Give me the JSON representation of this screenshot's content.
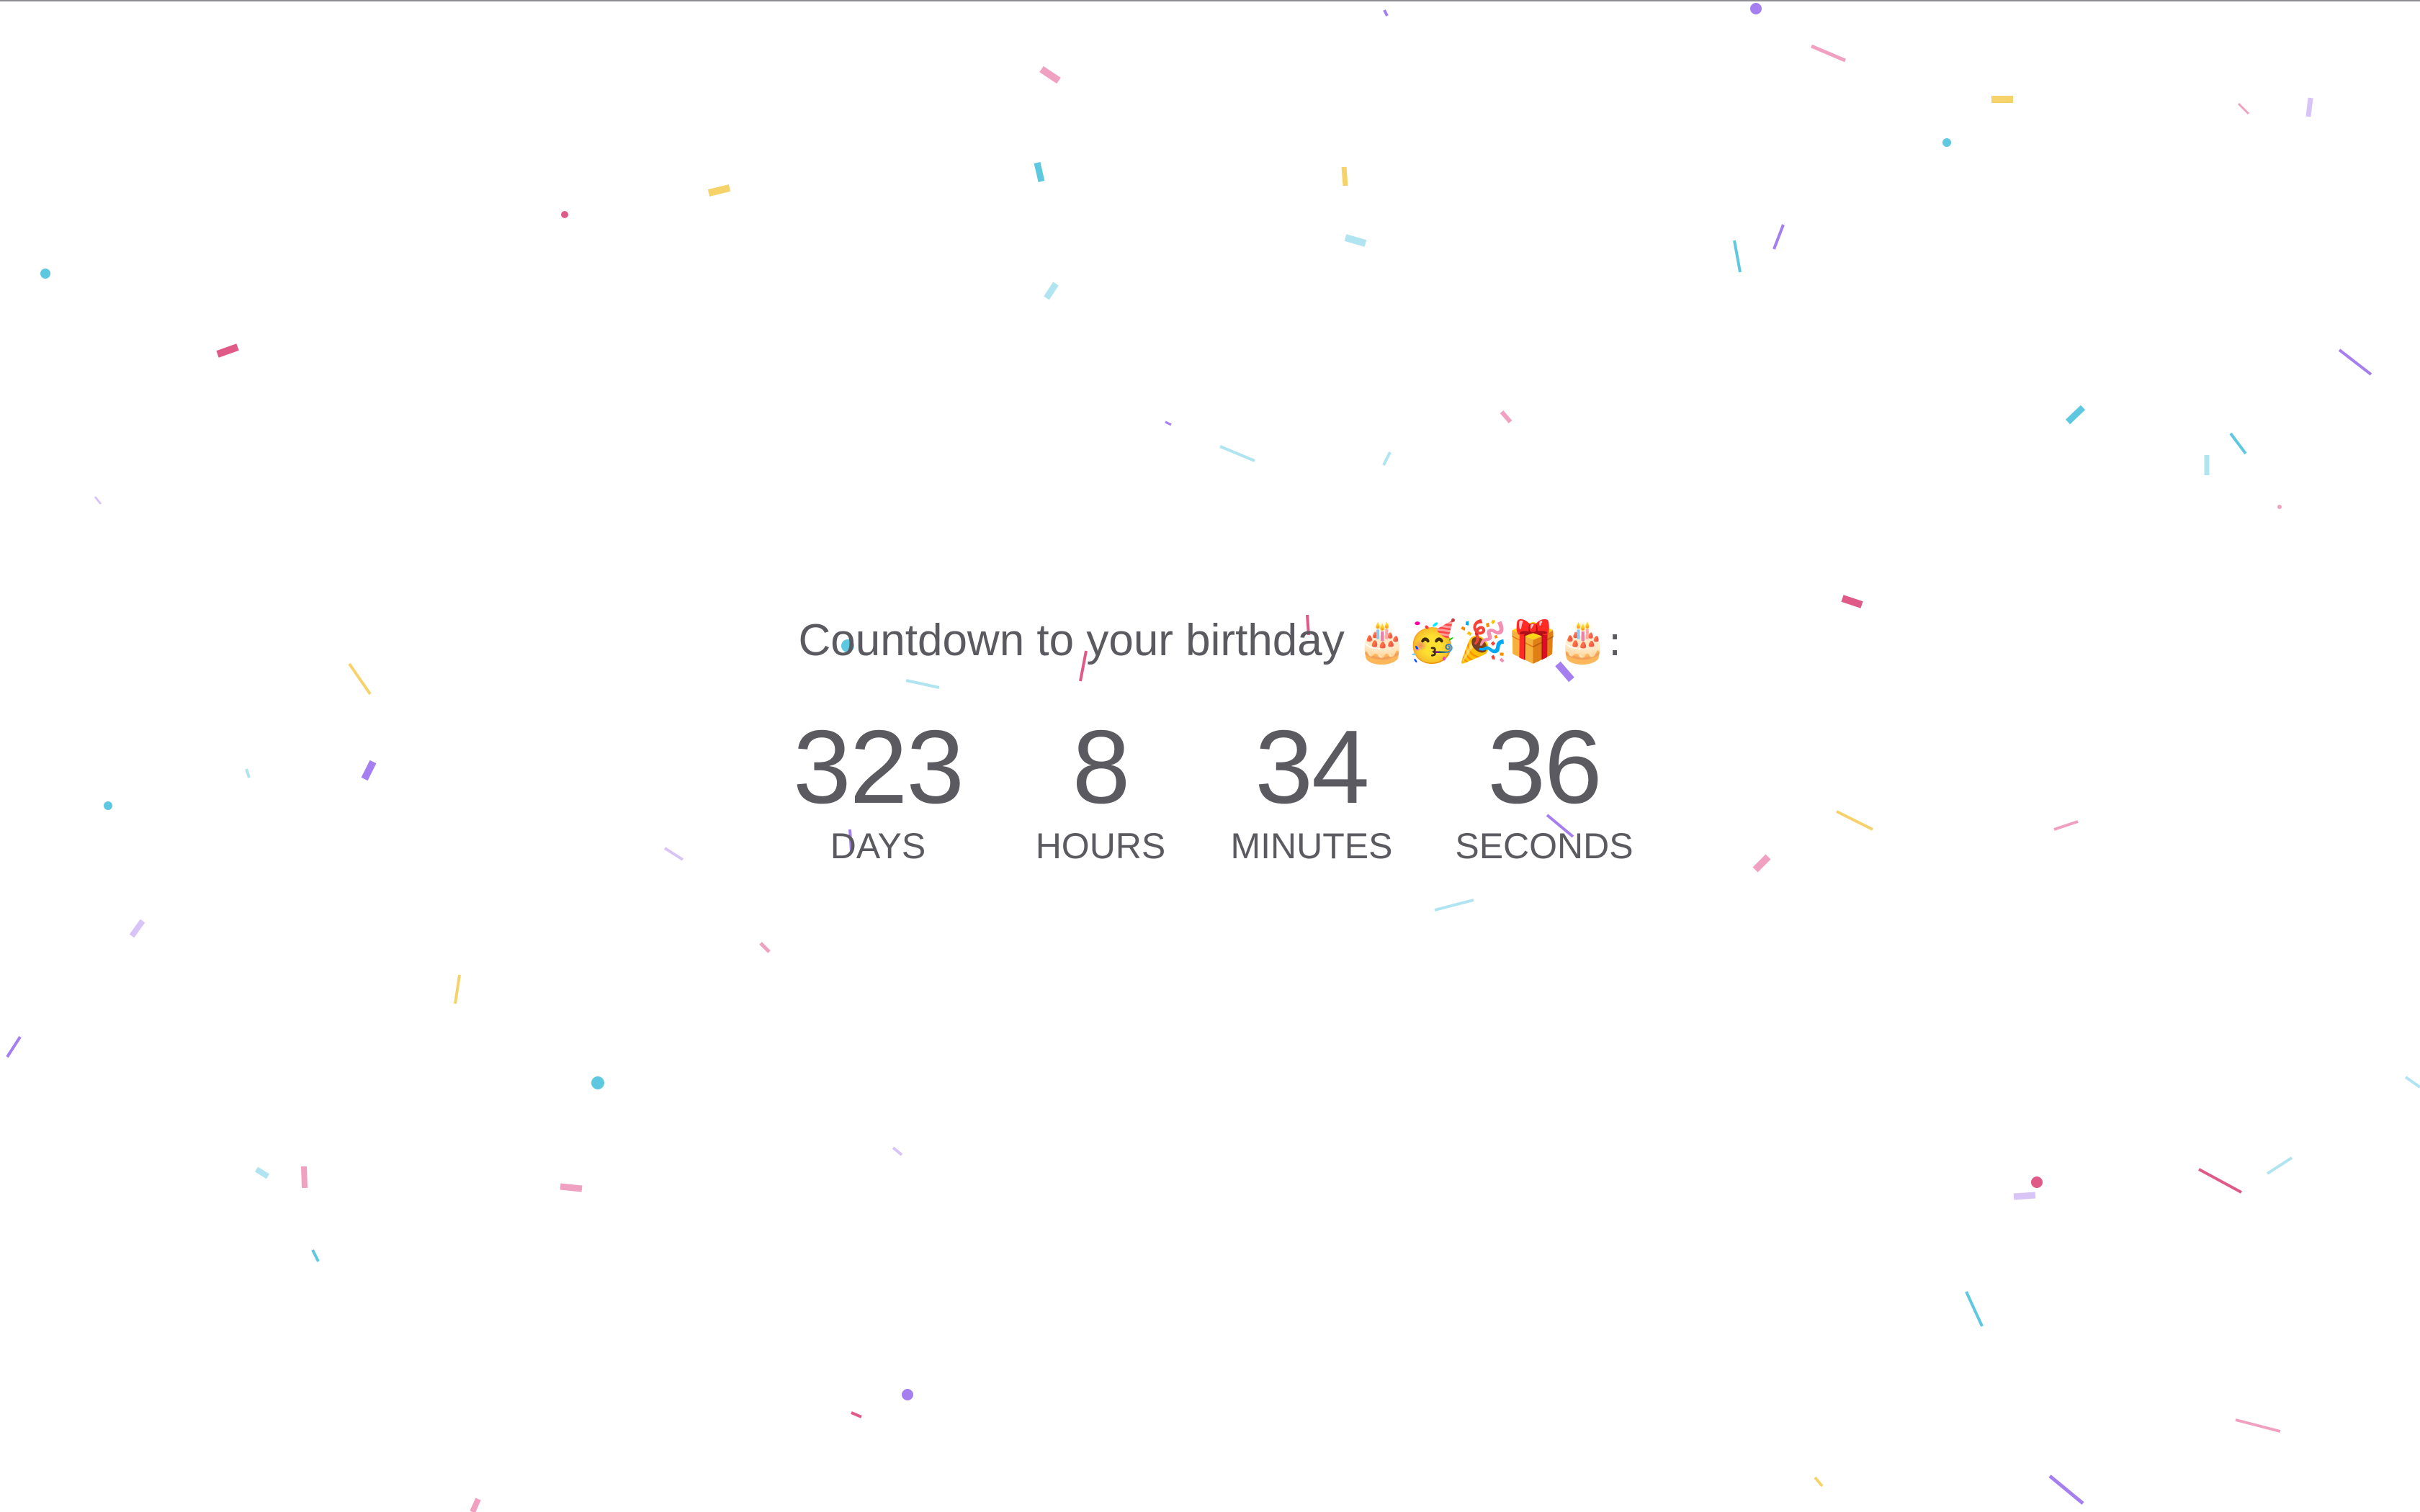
{
  "heading": {
    "text": "Countdown to your birthday",
    "emoji": "🎂🥳🎉🎁🎂:"
  },
  "countdown": {
    "days": {
      "value": "323",
      "label": "DAYS"
    },
    "hours": {
      "value": "8",
      "label": "HOURS"
    },
    "minutes": {
      "value": "34",
      "label": "MINUTES"
    },
    "seconds": {
      "value": "36",
      "label": "SECONDS"
    }
  },
  "colors": {
    "text": "#5a5a60",
    "background": "#ffffff",
    "confetti": [
      "#5ec8e0",
      "#a57ef0",
      "#e05a88",
      "#f5d36a",
      "#f0a0c0",
      "#b0e4f0",
      "#d8c4f7"
    ]
  }
}
